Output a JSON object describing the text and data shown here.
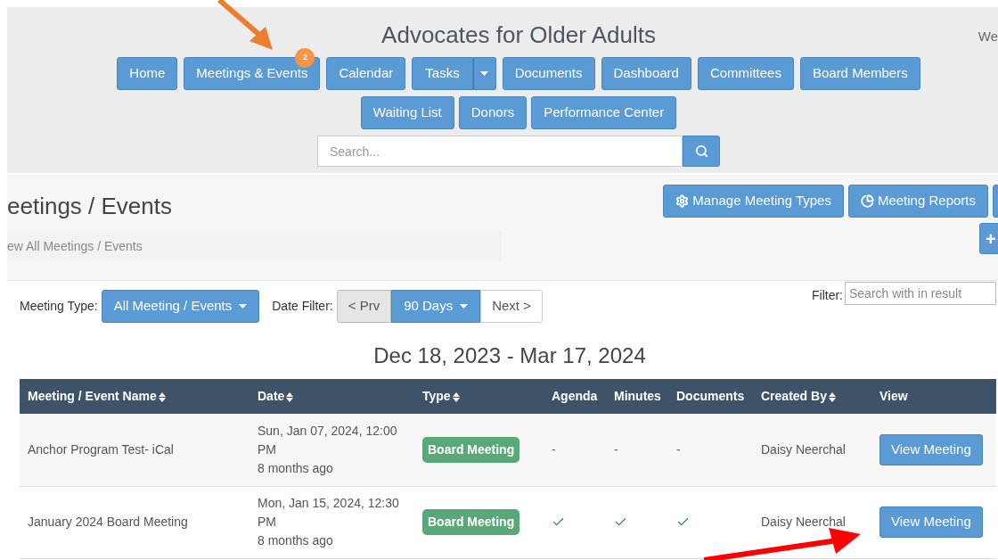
{
  "header": {
    "title": "Advocates for Older Adults",
    "welcome": "We",
    "nav": [
      {
        "label": "Home",
        "kind": "plain"
      },
      {
        "label": "Meetings & Events",
        "kind": "plain",
        "badge": "2"
      },
      {
        "label": "Calendar",
        "kind": "plain"
      },
      {
        "label": "Tasks",
        "kind": "split"
      },
      {
        "label": "Documents",
        "kind": "plain"
      },
      {
        "label": "Dashboard",
        "kind": "plain"
      },
      {
        "label": "Committees",
        "kind": "plain"
      },
      {
        "label": "Board Members",
        "kind": "plain"
      },
      {
        "label": "Waiting List",
        "kind": "plain"
      },
      {
        "label": "Donors",
        "kind": "plain"
      },
      {
        "label": "Performance Center",
        "kind": "plain"
      }
    ],
    "search": {
      "placeholder": "Search..."
    }
  },
  "page": {
    "title": "eetings / Events",
    "breadcrumb": "ew All Meetings / Events",
    "actions": [
      {
        "label": "Manage Meeting Types"
      },
      {
        "label": "Meeting Reports"
      }
    ],
    "add_button": "+"
  },
  "filters": {
    "meeting_type_label": "Meeting Type:",
    "meeting_type": "All Meeting / Events",
    "date_label": "Date Filter:",
    "prev": "< Prv",
    "range": "90 Days",
    "next": "Next >",
    "filter_label": "Filter:",
    "filter_placeholder": "Search with in result"
  },
  "range_title": "Dec 18, 2023 - Mar 17, 2024",
  "table": {
    "columns": [
      {
        "label": "Meeting / Event Name",
        "sortable": true
      },
      {
        "label": "Date",
        "sortable": true
      },
      {
        "label": "Type",
        "sortable": true
      },
      {
        "label": "Agenda",
        "sortable": false
      },
      {
        "label": "Minutes",
        "sortable": false
      },
      {
        "label": "Documents",
        "sortable": false
      },
      {
        "label": "Created By",
        "sortable": true
      },
      {
        "label": "View",
        "sortable": false
      }
    ],
    "rows": [
      {
        "name": "Anchor Program Test- iCal",
        "date": "Sun, Jan 07, 2024, 12:00 PM",
        "ago": "8 months ago",
        "type": "Board Meeting",
        "agenda": {
          "done": false,
          "text": "-"
        },
        "minutes": {
          "done": false,
          "text": "-"
        },
        "documents": {
          "done": false,
          "text": "-"
        },
        "created_by": "Daisy Neerchal",
        "action": "View Meeting"
      },
      {
        "name": "January 2024 Board Meeting",
        "date": "Mon, Jan 15, 2024, 12:30 PM",
        "ago": "8 months ago",
        "type": "Board Meeting",
        "agenda": {
          "done": true
        },
        "minutes": {
          "done": true
        },
        "documents": {
          "done": true
        },
        "created_by": "Daisy Neerchal",
        "action": "View Meeting"
      }
    ]
  }
}
